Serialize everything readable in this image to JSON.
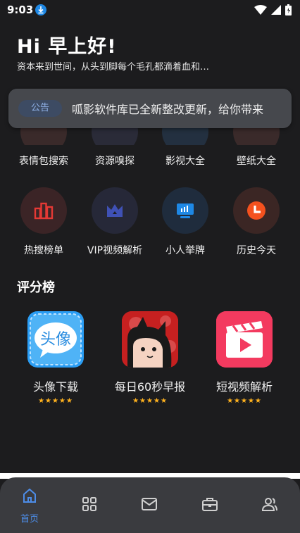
{
  "status": {
    "time": "9:03"
  },
  "header": {
    "greeting": "Hi 早上好!",
    "subtitle": "资本来到世间，从头到脚每个毛孔都滴着血和…"
  },
  "notice": {
    "badge": "公告",
    "text": "呱影软件库已全新整改更新，给你带来"
  },
  "grid_row1": [
    {
      "label": "表情包搜索",
      "icon": "emoji-search-icon"
    },
    {
      "label": "资源嗅探",
      "icon": "resource-sniff-icon"
    },
    {
      "label": "影视大全",
      "icon": "movie-icon"
    },
    {
      "label": "壁纸大全",
      "icon": "wallpaper-icon"
    }
  ],
  "grid_row2": [
    {
      "label": "热搜榜单",
      "icon": "hot-chart-icon",
      "color": "#e53935"
    },
    {
      "label": "VIP视频解析",
      "icon": "crown-icon",
      "color": "#3f51b5"
    },
    {
      "label": "小人举牌",
      "icon": "signboard-icon",
      "color": "#1e88e5"
    },
    {
      "label": "历史今天",
      "icon": "clock-icon",
      "color": "#f4511e"
    }
  ],
  "ratings": {
    "title": "评分榜",
    "apps": [
      {
        "name": "头像下载",
        "stars": "★★★★★"
      },
      {
        "name": "每日60秒早报",
        "stars": "★★★★★"
      },
      {
        "name": "短视频解析",
        "stars": "★★★★★"
      }
    ]
  },
  "nav": {
    "home_label": "首页",
    "items": [
      "home-icon",
      "apps-icon",
      "mail-icon",
      "toolbox-icon",
      "user-icon"
    ]
  },
  "colors": {
    "accent": "#4d8de8",
    "background": "#1c1c1e",
    "star": "#ffb21e"
  }
}
